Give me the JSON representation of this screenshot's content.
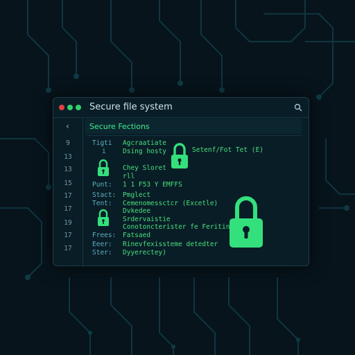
{
  "window": {
    "title": "Secure file system",
    "controls": [
      "close",
      "minimize",
      "maximize"
    ],
    "search_icon": "search-icon"
  },
  "sidebar": {
    "back_icon": "chevron-left-icon",
    "line_numbers": [
      "9",
      "13",
      "13",
      "15",
      "17",
      "17",
      "19",
      "17",
      "17"
    ]
  },
  "panel": {
    "header": "Secure Fections",
    "labels": [
      "Tigti",
      "i",
      "Punt:",
      "Stact:",
      "Tent:",
      "Frees:",
      "Eeer:",
      "Ster:"
    ],
    "rows": [
      "Agcraatiate",
      "Dsing hosty",
      "Chey Sloret",
      "rll",
      "1 1 F53 Y EMFFS",
      "Pmglect",
      "Cemenomessctcr (Excetle)",
      "Dvkedee",
      "Srdervaistie",
      "Conotoncterister fe Feritiny",
      "Fatsaed",
      "Rinevfexissteme detedter",
      "Dyyerectey)"
    ],
    "lock_caption": "Setenf/Fot Tet (E)"
  },
  "colors": {
    "accent": "#3ff08a",
    "background": "#07141c",
    "window": "#0a1e28",
    "label": "#5fb0c0"
  },
  "icons": [
    "lock-icon",
    "search-icon",
    "chevron-left-icon"
  ]
}
